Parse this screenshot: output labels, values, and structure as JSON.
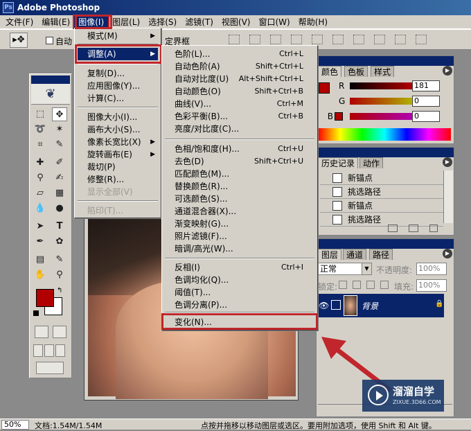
{
  "app": {
    "title": "Adobe Photoshop"
  },
  "menubar": {
    "items": [
      "文件(F)",
      "编辑(E)",
      "图像(I)",
      "图层(L)",
      "选择(S)",
      "滤镜(T)",
      "视图(V)",
      "窗口(W)",
      "帮助(H)"
    ],
    "active_index": 2
  },
  "options_bar": {
    "auto_select_label": "自动",
    "bounding_box_label": "定界框"
  },
  "image_menu": {
    "items": [
      {
        "label": "模式(M)",
        "submenu": true
      },
      {
        "label": "调整(A)",
        "submenu": true,
        "selected": true
      },
      {
        "label": "复制(D)..."
      },
      {
        "label": "应用图像(Y)..."
      },
      {
        "label": "计算(C)..."
      },
      {
        "label": "图像大小(I)..."
      },
      {
        "label": "画布大小(S)..."
      },
      {
        "label": "像素长宽比(X)",
        "submenu": true
      },
      {
        "label": "旋转画布(E)",
        "submenu": true
      },
      {
        "label": "裁切(P)"
      },
      {
        "label": "修整(R)..."
      },
      {
        "label": "显示全部(V)",
        "disabled": true
      },
      {
        "label": "陷印(T)...",
        "disabled": true
      }
    ]
  },
  "adjust_menu": {
    "items": [
      {
        "label": "色阶(L)...",
        "shortcut": "Ctrl+L"
      },
      {
        "label": "自动色阶(A)",
        "shortcut": "Shift+Ctrl+L"
      },
      {
        "label": "自动对比度(U)",
        "shortcut": "Alt+Shift+Ctrl+L"
      },
      {
        "label": "自动颜色(O)",
        "shortcut": "Shift+Ctrl+B"
      },
      {
        "label": "曲线(V)...",
        "shortcut": "Ctrl+M"
      },
      {
        "label": "色彩平衡(B)...",
        "shortcut": "Ctrl+B"
      },
      {
        "label": "亮度/对比度(C)...",
        "shortcut": ""
      },
      {
        "label": "色相/饱和度(H)...",
        "shortcut": "Ctrl+U"
      },
      {
        "label": "去色(D)",
        "shortcut": "Shift+Ctrl+U"
      },
      {
        "label": "匹配颜色(M)...",
        "shortcut": ""
      },
      {
        "label": "替换颜色(R)...",
        "shortcut": ""
      },
      {
        "label": "可选颜色(S)...",
        "shortcut": ""
      },
      {
        "label": "通道混合器(X)...",
        "shortcut": ""
      },
      {
        "label": "渐变映射(G)...",
        "shortcut": ""
      },
      {
        "label": "照片滤镜(F)...",
        "shortcut": ""
      },
      {
        "label": "暗调/高光(W)...",
        "shortcut": ""
      },
      {
        "label": "反相(I)",
        "shortcut": "Ctrl+I"
      },
      {
        "label": "色调均化(Q)...",
        "shortcut": ""
      },
      {
        "label": "阈值(T)...",
        "shortcut": ""
      },
      {
        "label": "色调分离(P)...",
        "shortcut": ""
      },
      {
        "label": "变化(N)...",
        "shortcut": ""
      }
    ]
  },
  "color_panel": {
    "tabs": [
      "颜色",
      "色板",
      "样式"
    ],
    "r_label": "R",
    "g_label": "G",
    "b_label": "B",
    "r_value": "181",
    "g_value": "0",
    "b_value": "0"
  },
  "history_panel": {
    "tabs": [
      "历史记录",
      "动作"
    ],
    "items": [
      "新锚点",
      "挑选路径",
      "新锚点",
      "挑选路径"
    ]
  },
  "layers_panel": {
    "tabs": [
      "图层",
      "通道",
      "路径"
    ],
    "blend_mode": "正常",
    "opacity_label": "不透明度:",
    "opacity_value": "100%",
    "lock_label": "锁定:",
    "fill_label": "填充:",
    "fill_value": "100%",
    "layer_name": "背景"
  },
  "status_bar": {
    "zoom": "50%",
    "doc_size": "文档:1.54M/1.54M",
    "hint": "点按并拖移以移动图层或选区。要用附加选项，使用 Shift 和 Alt 键。"
  },
  "watermark": {
    "brand": "溜溜自学",
    "url": "ZIXUE.3D66.COM"
  },
  "colors": {
    "foreground": "#b00000",
    "background": "#ffffff",
    "highlight": "#c0262b",
    "menu_selected": "#0a246a"
  }
}
